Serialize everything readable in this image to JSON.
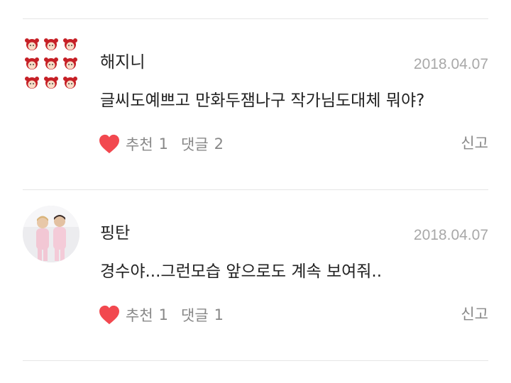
{
  "comments": [
    {
      "author": "해지니",
      "date": "2018.04.07",
      "text": "글씨도예쁘고 만화두잼나구 작가님도대체 뭐야?",
      "like_label": "추천",
      "like_count": "1",
      "reply_label": "댓글",
      "reply_count": "2",
      "report_label": "신고",
      "avatar_icon": "cartoon-grid-avatar"
    },
    {
      "author": "핑탄",
      "date": "2018.04.07",
      "text": "경수야...그런모습 앞으로도 계속 보여줘..",
      "like_label": "추천",
      "like_count": "1",
      "reply_label": "댓글",
      "reply_count": "1",
      "report_label": "신고",
      "avatar_icon": "photo-avatar"
    }
  ],
  "colors": {
    "heart": "#f2484f",
    "text": "#222222",
    "meta": "#a8a8a8",
    "action": "#888888",
    "divider": "#e6e6e6"
  },
  "icons": [
    "heart-icon"
  ]
}
